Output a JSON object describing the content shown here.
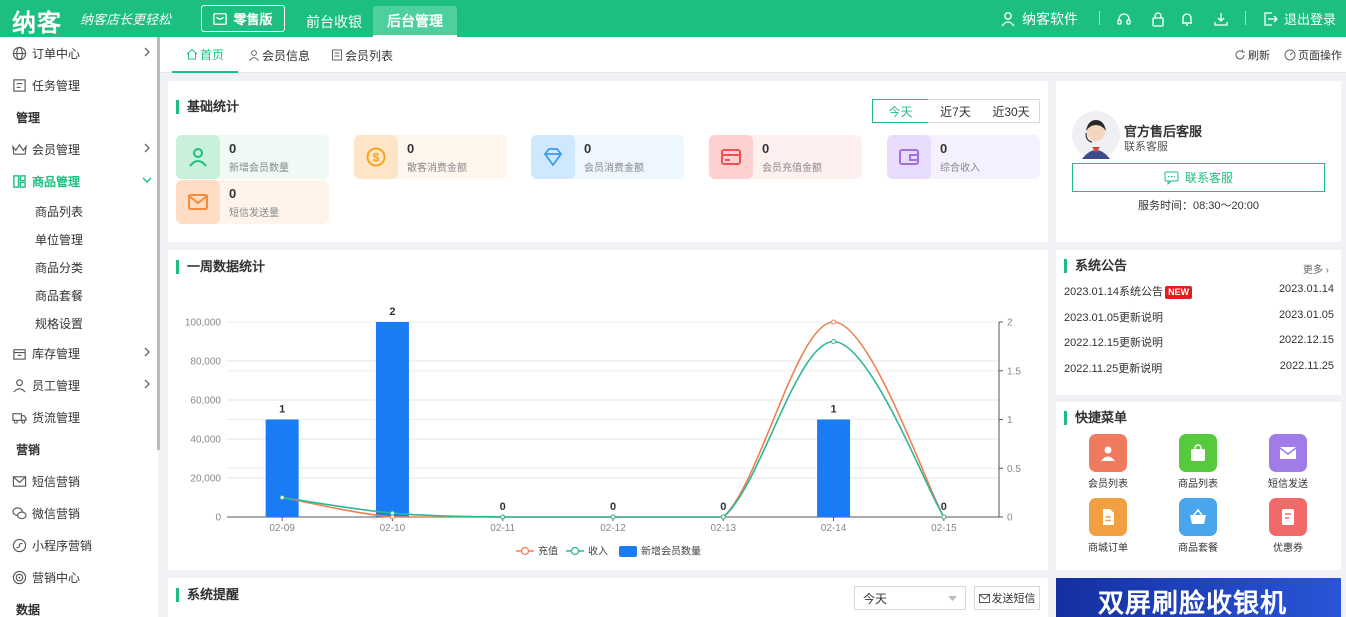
{
  "topbar": {
    "logo": "纳客",
    "slogan": "纳客店长更轻松",
    "edition": "零售版",
    "nav_front": "前台收银",
    "nav_back": "后台管理",
    "user": "纳客软件",
    "logout": "退出登录"
  },
  "sidebar": {
    "order_center": "订单中心",
    "task_mgmt": "任务管理",
    "sec_manage": "管理",
    "member_mgmt": "会员管理",
    "goods_mgmt": "商品管理",
    "goods_list": "商品列表",
    "unit_mgmt": "单位管理",
    "goods_category": "商品分类",
    "goods_package": "商品套餐",
    "spec_setting": "规格设置",
    "stock_mgmt": "库存管理",
    "staff_mgmt": "员工管理",
    "logistics_mgmt": "货流管理",
    "sec_marketing": "营销",
    "sms_marketing": "短信营销",
    "wechat_marketing": "微信营销",
    "mini_marketing": "小程序营销",
    "marketing_center": "营销中心",
    "sec_data": "数据"
  },
  "tabs": {
    "home": "首页",
    "member_info": "会员信息",
    "member_list": "会员列表",
    "refresh": "刷新",
    "page_ops": "页面操作"
  },
  "basic": {
    "title": "基础统计",
    "range_today": "今天",
    "range_7": "近7天",
    "range_30": "近30天",
    "s1_val": "0",
    "s1_label": "新增会员数量",
    "s2_val": "0",
    "s2_label": "散客消费金额",
    "s3_val": "0",
    "s3_label": "会员消费金额",
    "s4_val": "0",
    "s4_label": "会员充值金额",
    "s5_val": "0",
    "s5_label": "综合收入",
    "s6_val": "0",
    "s6_label": "短信发送量"
  },
  "service": {
    "title": "官方售后客服",
    "subtitle": "联系客服",
    "button": "联系客服",
    "hours": "服务时间：08:30～20:00"
  },
  "weekly": {
    "title": "一周数据统计"
  },
  "chart_data": {
    "type": "bar",
    "categories": [
      "02-09",
      "02-10",
      "02-11",
      "02-12",
      "02-13",
      "02-14",
      "02-15"
    ],
    "series": [
      {
        "name": "新增会员数量",
        "type": "bar",
        "axis": "right",
        "values": [
          1,
          2,
          0,
          0,
          0,
          1,
          0
        ]
      },
      {
        "name": "充值",
        "type": "line",
        "axis": "left",
        "values": [
          10000,
          0,
          0,
          0,
          0,
          100000,
          0
        ]
      },
      {
        "name": "收入",
        "type": "line",
        "axis": "left",
        "values": [
          10000,
          2000,
          0,
          0,
          0,
          90000,
          0
        ]
      }
    ],
    "y_left_ticks": [
      "0",
      "20,000",
      "40,000",
      "60,000",
      "80,000",
      "100,000"
    ],
    "y_right_ticks": [
      "0",
      "0.5",
      "1",
      "1.5",
      "2"
    ],
    "ylim_left": [
      0,
      100000
    ],
    "ylim_right": [
      0,
      2
    ],
    "bar_labels": [
      "1",
      "2",
      "0",
      "0",
      "0",
      "1",
      "0"
    ],
    "legend_position": "bottom",
    "colors": {
      "bar": "#1a7cf5",
      "recharge": "#f08050",
      "income": "#2fb59a"
    }
  },
  "notice": {
    "title": "系统公告",
    "more": "更多",
    "items": [
      {
        "title": "2023.01.14系统公告",
        "badge": "NEW",
        "date": "2023.01.14"
      },
      {
        "title": "2023.01.05更新说明",
        "date": "2023.01.05"
      },
      {
        "title": "2022.12.15更新说明",
        "date": "2022.12.15"
      },
      {
        "title": "2022.11.25更新说明",
        "date": "2022.11.25"
      }
    ]
  },
  "quick": {
    "title": "快捷菜单",
    "items": [
      {
        "label": "会员列表",
        "icon": "user-icon",
        "color": "#f07a5f"
      },
      {
        "label": "商品列表",
        "icon": "shopping-bag-icon",
        "color": "#56c93c"
      },
      {
        "label": "短信发送",
        "icon": "envelope-icon",
        "color": "#a07de6"
      },
      {
        "label": "商城订单",
        "icon": "document-icon",
        "color": "#f0a040"
      },
      {
        "label": "商品套餐",
        "icon": "basket-icon",
        "color": "#4aa6ec"
      },
      {
        "label": "优惠券",
        "icon": "coupon-icon",
        "color": "#f06a6a"
      }
    ]
  },
  "reminder": {
    "title": "系统提醒",
    "select_value": "今天",
    "send_sms": "发送短信"
  },
  "banner": {
    "text": "双屏刷脸收银机"
  }
}
